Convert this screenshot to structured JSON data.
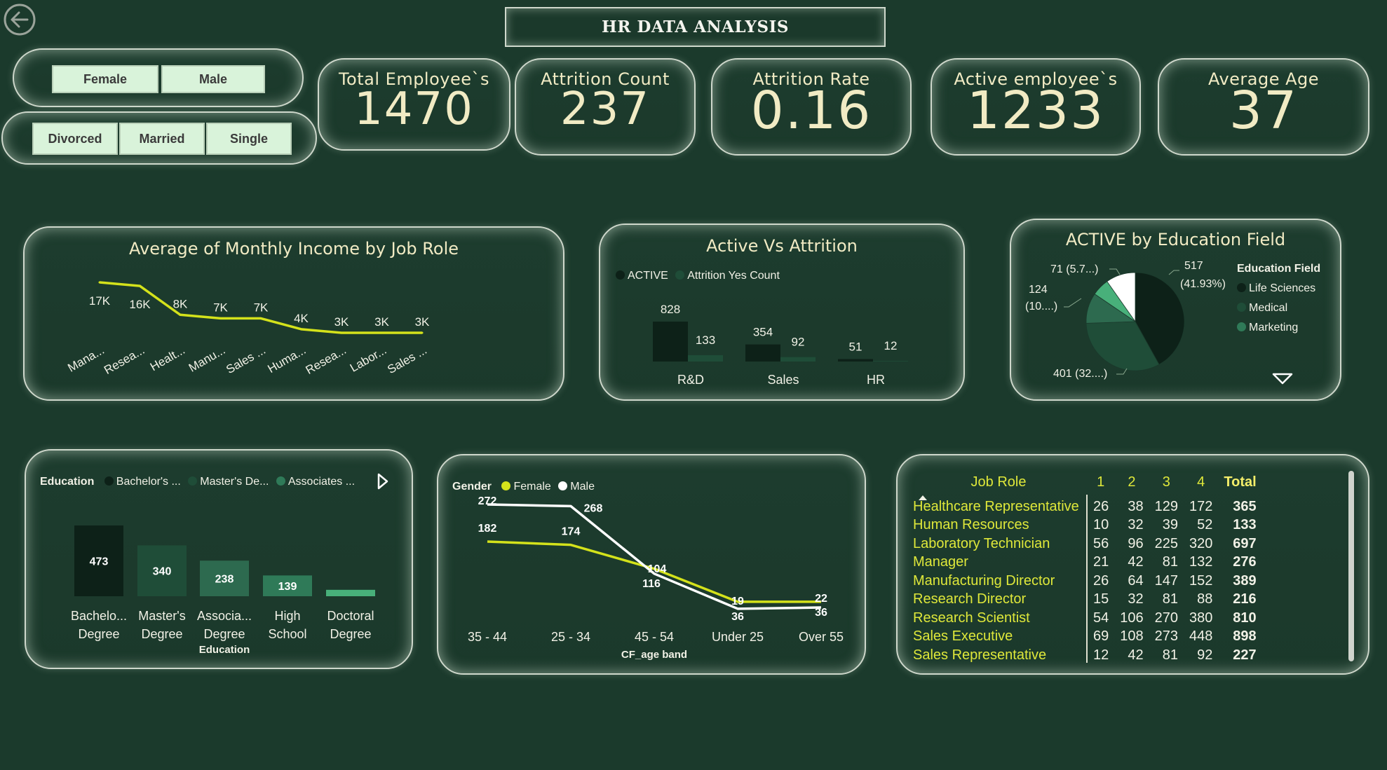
{
  "header": {
    "title": "HR DATA ANALYSIS",
    "back_icon": "back-arrow-icon"
  },
  "slicers": {
    "gender": [
      "Female",
      "Male"
    ],
    "marital": [
      "Divorced",
      "Married",
      "Single"
    ]
  },
  "kpis": [
    {
      "label": "Total Employee`s",
      "value": "1470"
    },
    {
      "label": "Attrition Count",
      "value": "237"
    },
    {
      "label": "Attrition Rate",
      "value": "0.16"
    },
    {
      "label": "Active employee`s",
      "value": "1233"
    },
    {
      "label": "Average Age",
      "value": "37"
    }
  ],
  "colors": {
    "background": "#1b3a2c",
    "accent_yellow": "#d4e21b",
    "dark_green": "#0d2118",
    "mid_green": "#1f4d38",
    "light_green": "#2f7a58",
    "bright_green": "#48b07a"
  },
  "chart_data": [
    {
      "id": "income",
      "type": "line",
      "title": "Average of Monthly Income by Job Role",
      "categories": [
        "Mana...",
        "Resea...",
        "Healt...",
        "Manu...",
        "Sales ...",
        "Huma...",
        "Resea...",
        "Labor...",
        "Sales ..."
      ],
      "values": [
        17,
        16,
        8,
        7,
        7,
        4,
        3,
        3,
        3
      ],
      "labels": [
        "17K",
        "16K",
        "8K",
        "7K",
        "7K",
        "4K",
        "3K",
        "3K",
        "3K"
      ]
    },
    {
      "id": "active_attrition",
      "type": "bar",
      "title": "Active Vs Attrition",
      "legend": [
        "ACTIVE",
        "Attrition Yes Count"
      ],
      "categories": [
        "R&D",
        "Sales",
        "HR"
      ],
      "series": [
        {
          "name": "ACTIVE",
          "values": [
            828,
            354,
            51
          ]
        },
        {
          "name": "Attrition Yes Count",
          "values": [
            133,
            92,
            12
          ]
        }
      ]
    },
    {
      "id": "edu_field",
      "type": "pie",
      "title": "ACTIVE by Education Field",
      "legend_title": "Education Field",
      "legend": [
        "Life Sciences",
        "Medical",
        "Marketing"
      ],
      "slices": [
        {
          "value": 517,
          "label": "517",
          "sublabel": "(41.93%)"
        },
        {
          "value": 401,
          "label": "401 (32....)"
        },
        {
          "value": 124,
          "label": "124",
          "sublabel": "(10....)"
        },
        {
          "value": 71,
          "label": "71 (5.7...)"
        },
        {
          "value": 120,
          "label": ""
        }
      ]
    },
    {
      "id": "education",
      "type": "bar",
      "legend_title": "Education",
      "legend": [
        "Bachelor's ...",
        "Master's De...",
        "Associates ..."
      ],
      "axis_title": "Education",
      "categories": [
        [
          "Bachelo...",
          "Degree"
        ],
        [
          "Master's",
          "Degree"
        ],
        [
          "Associa...",
          "Degree"
        ],
        [
          "High",
          "School"
        ],
        [
          "Doctoral",
          "Degree"
        ]
      ],
      "values": [
        473,
        340,
        238,
        139,
        43
      ],
      "labels": [
        "473",
        "340",
        "238",
        "139",
        ""
      ]
    },
    {
      "id": "gender_age",
      "type": "line",
      "legend_title": "Gender",
      "legend": [
        "Female",
        "Male"
      ],
      "xlabel": "CF_age band",
      "categories": [
        "35 - 44",
        "25 - 34",
        "45 - 54",
        "Under 25",
        "Over 55"
      ],
      "series": [
        {
          "name": "Female",
          "values": [
            182,
            174,
            116,
            36,
            36
          ]
        },
        {
          "name": "Male",
          "values": [
            272,
            268,
            104,
            19,
            22
          ]
        }
      ]
    }
  ],
  "job_table": {
    "headers": [
      "Job Role",
      "1",
      "2",
      "3",
      "4",
      "Total"
    ],
    "rows": [
      [
        "Healthcare Representative",
        "26",
        "38",
        "129",
        "172",
        "365"
      ],
      [
        "Human Resources",
        "10",
        "32",
        "39",
        "52",
        "133"
      ],
      [
        "Laboratory Technician",
        "56",
        "96",
        "225",
        "320",
        "697"
      ],
      [
        "Manager",
        "21",
        "42",
        "81",
        "132",
        "276"
      ],
      [
        "Manufacturing Director",
        "26",
        "64",
        "147",
        "152",
        "389"
      ],
      [
        "Research Director",
        "15",
        "32",
        "81",
        "88",
        "216"
      ],
      [
        "Research Scientist",
        "54",
        "106",
        "270",
        "380",
        "810"
      ],
      [
        "Sales Executive",
        "69",
        "108",
        "273",
        "448",
        "898"
      ],
      [
        "Sales Representative",
        "12",
        "42",
        "81",
        "92",
        "227"
      ]
    ]
  }
}
